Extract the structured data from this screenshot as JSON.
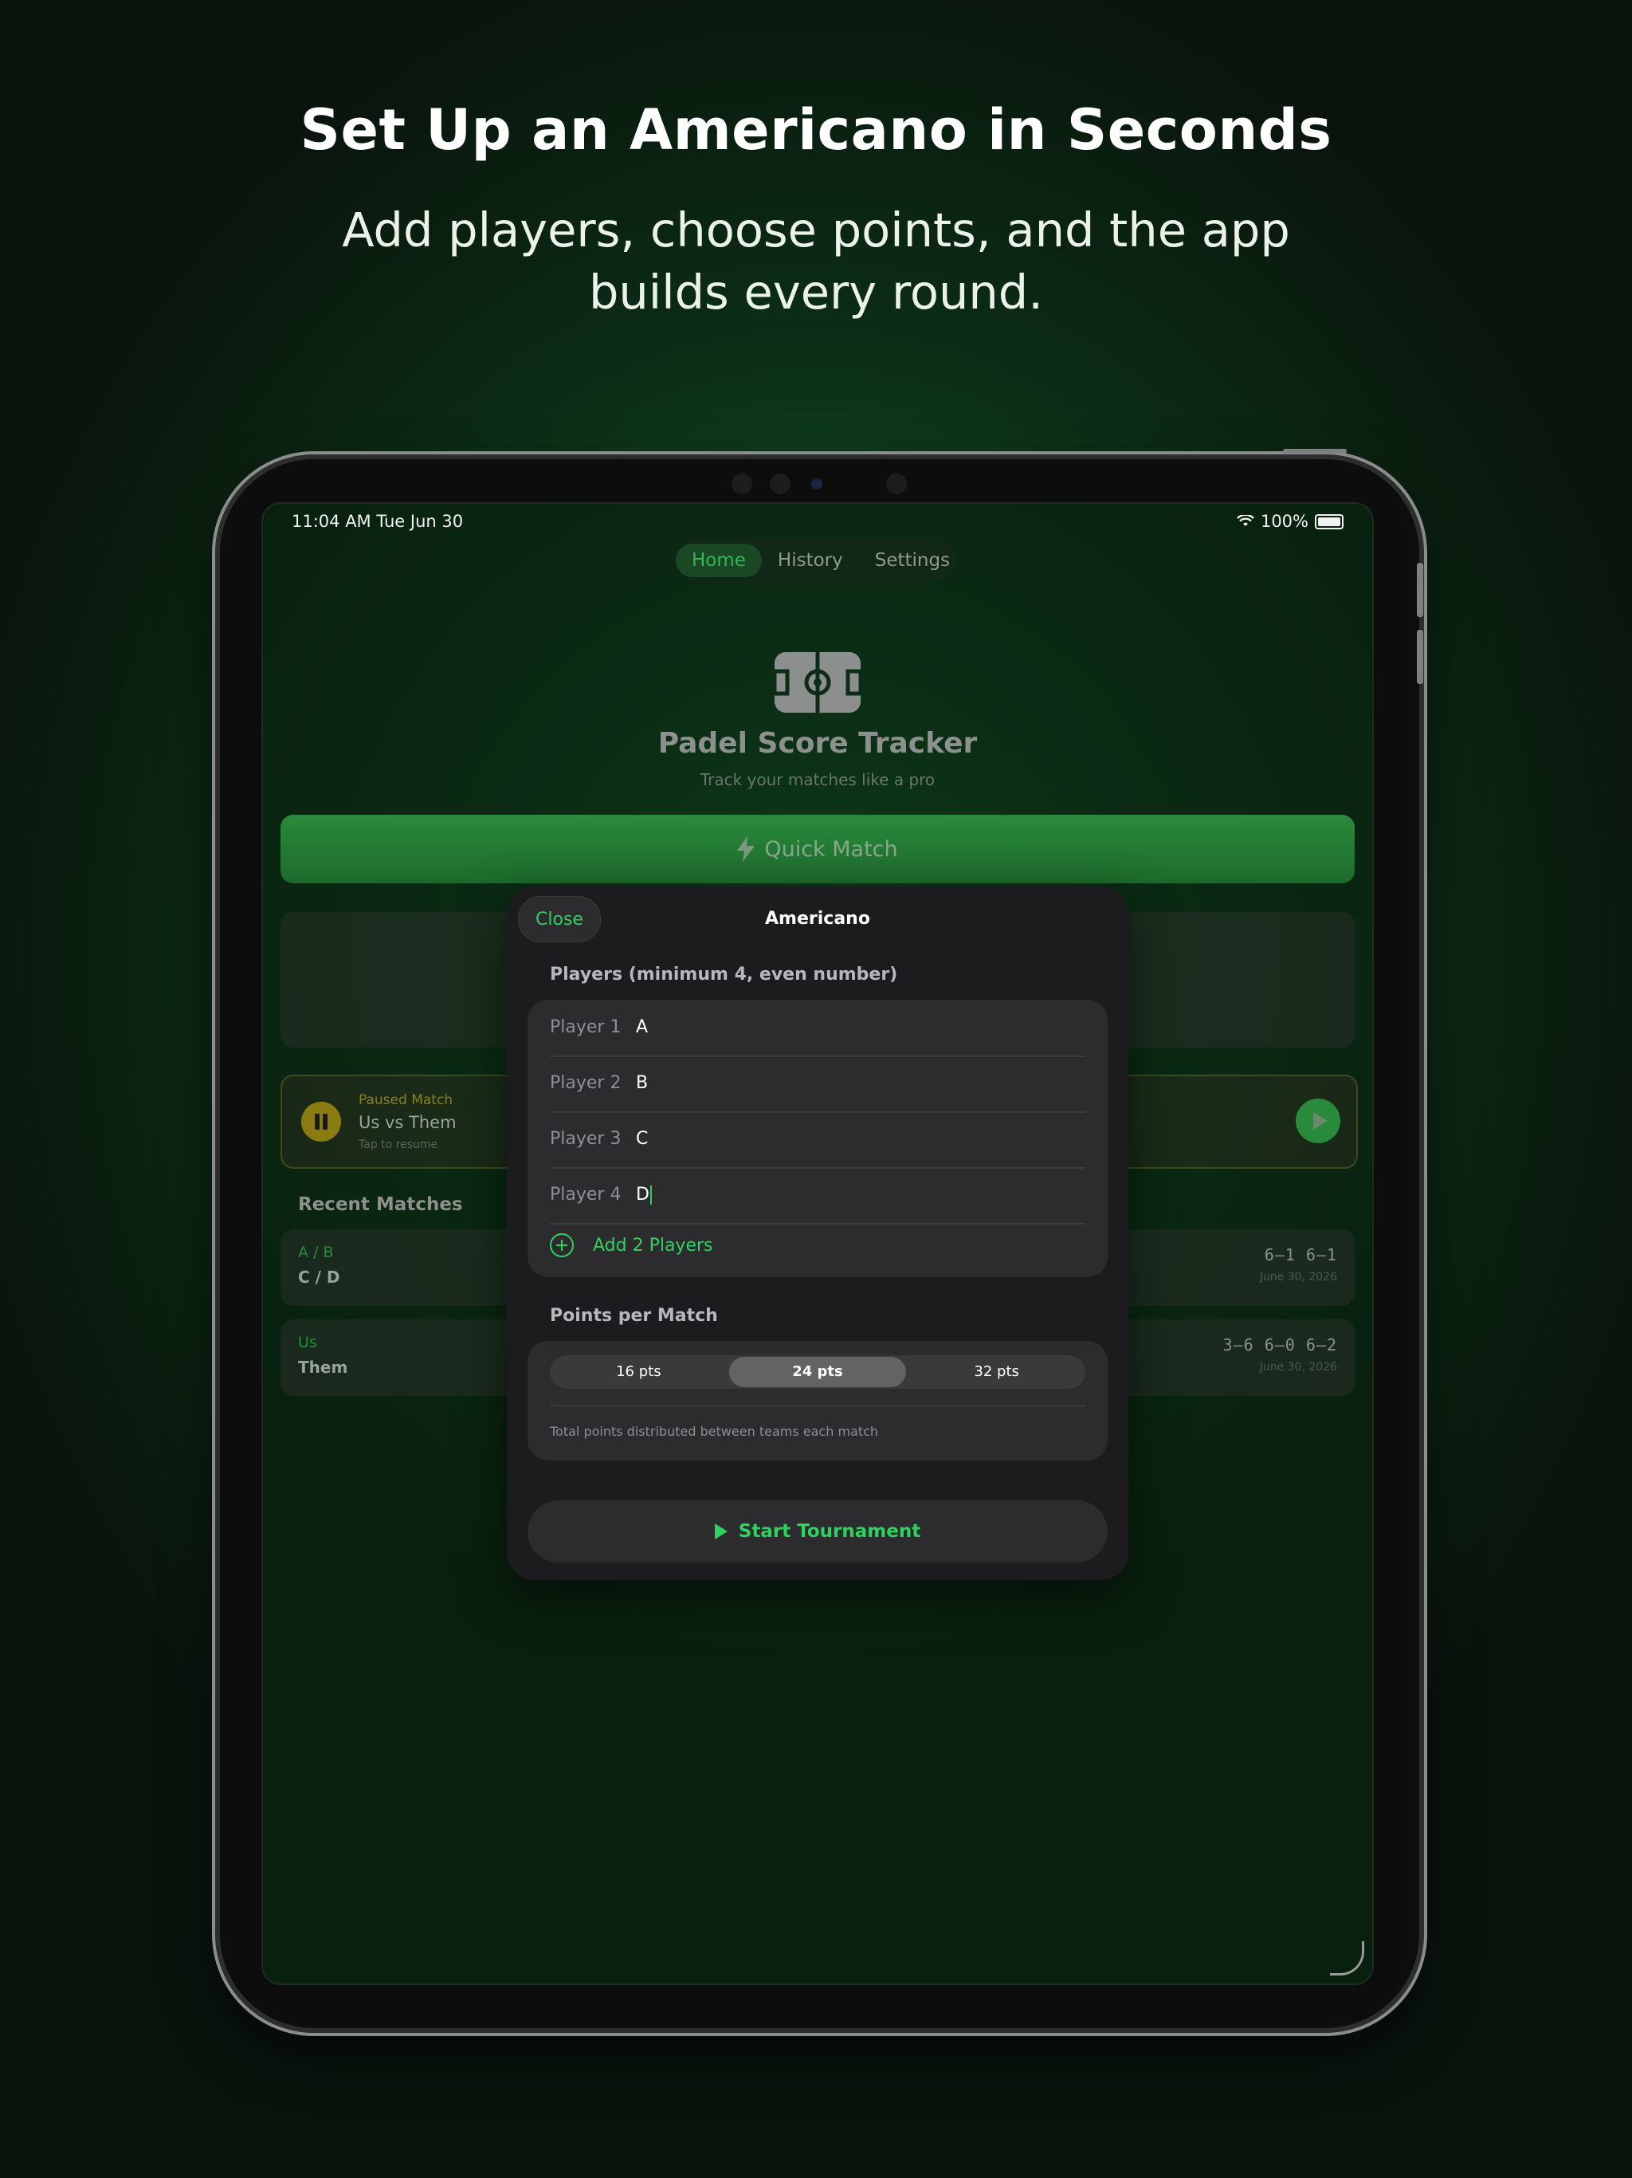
{
  "marketing": {
    "title": "Set Up an Americano in Seconds",
    "subtitle": "Add players, choose points, and the app builds every round."
  },
  "status_bar": {
    "time": "11:04 AM  Tue Jun 30",
    "battery": "100%"
  },
  "tabs": [
    {
      "label": "Home",
      "active": true
    },
    {
      "label": "History",
      "active": false
    },
    {
      "label": "Settings",
      "active": false
    }
  ],
  "home": {
    "app_name": "Padel Score Tracker",
    "tagline": "Track your matches like a pro",
    "quick_match_label": "Quick Match",
    "paused": {
      "label": "Paused Match",
      "title": "Us  vs  Them",
      "hint": "Tap to resume"
    },
    "recent_title": "Recent Matches",
    "recent_matches": [
      {
        "team_a": "A / B",
        "team_b": "C / D",
        "scores": "6–1   6–1",
        "date": "June 30, 2026"
      },
      {
        "team_a": "Us",
        "team_b": "Them",
        "scores": "3–6   6–0   6–2",
        "date": "June 30, 2026"
      }
    ]
  },
  "modal": {
    "close_label": "Close",
    "title": "Americano",
    "players_section": "Players (minimum 4, even number)",
    "players": [
      {
        "label": "Player 1",
        "value": "A"
      },
      {
        "label": "Player 2",
        "value": "B"
      },
      {
        "label": "Player 3",
        "value": "C"
      },
      {
        "label": "Player 4",
        "value": "D"
      }
    ],
    "add_players_label": "Add 2 Players",
    "points_section": "Points per Match",
    "points_options": [
      "16 pts",
      "24 pts",
      "32 pts"
    ],
    "points_selected": "24 pts",
    "points_hint": "Total points distributed between teams each match",
    "start_label": "Start Tournament"
  },
  "colors": {
    "accent": "#32d060",
    "paused": "#8a7c10",
    "modal_bg": "#1c1c1e"
  }
}
